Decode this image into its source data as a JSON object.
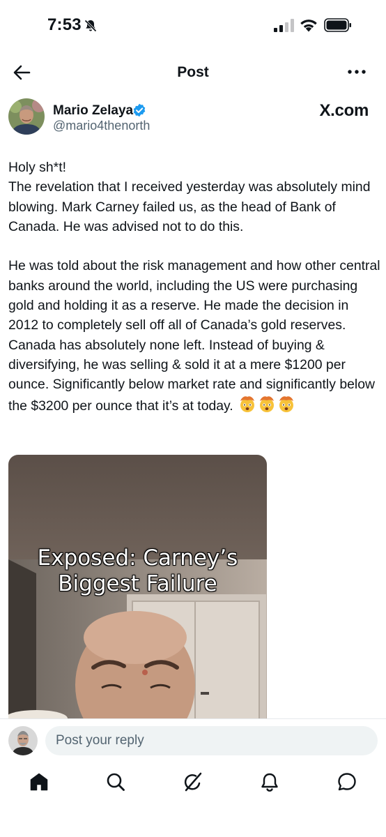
{
  "status_bar": {
    "time": "7:53",
    "icons": [
      "bell-off-icon",
      "signal-icon",
      "wifi-icon",
      "battery-icon"
    ]
  },
  "nav": {
    "title": "Post",
    "back_icon": "back-arrow-icon",
    "more_icon": "more-icon"
  },
  "author": {
    "name": "Mario Zelaya",
    "handle": "@mario4thenorth",
    "verified": true,
    "verified_color": "#1d9bf0",
    "source": "X.com"
  },
  "post": {
    "paragraphs": [
      "Holy sh*t!",
      "The revelation that I received yesterday was absolutely mind blowing. Mark Carney failed us, as the head of Bank of Canada. He was advised not to do this.",
      "",
      "He was told about the risk management and how other central banks around the world, including the US were purchasing gold and holding it as a reserve. He made the decision in 2012 to completely sell off all of Canada’s gold reserves. Canada has absolutely none left. Instead of buying & diversifying, he was selling & sold it at a mere $1200 per ounce. Significantly below market rate and significantly below the $3200 per ounce that it’s at today."
    ],
    "trailing_emoji": [
      "exploding-head-emoji",
      "exploding-head-emoji",
      "exploding-head-emoji"
    ]
  },
  "media": {
    "caption_line_1": "Exposed: Carney’s",
    "caption_line_2": "Biggest Failure"
  },
  "reply": {
    "placeholder": "Post your reply"
  },
  "tab_bar": {
    "items": [
      "home-icon",
      "search-icon",
      "grok-icon",
      "notifications-icon",
      "messages-icon"
    ],
    "active": "home-icon"
  }
}
